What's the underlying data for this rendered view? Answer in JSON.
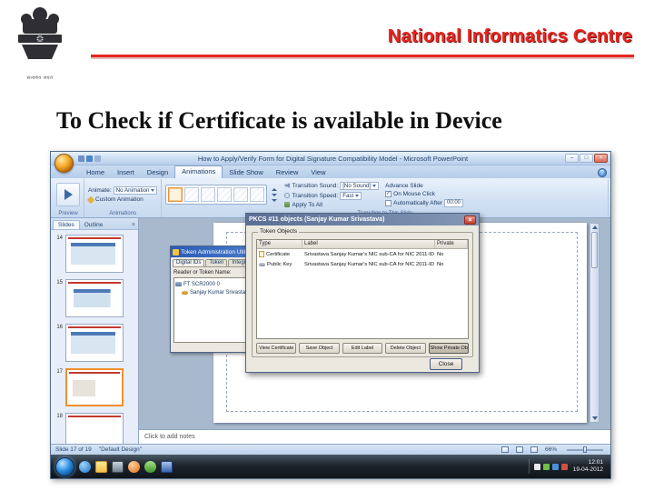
{
  "header": {
    "brand": "National Informatics Centre",
    "motto": "सत्यमेव जयते"
  },
  "title": "To Check if Certificate is available in Device",
  "ppt": {
    "window_title": "How to Apply/Verify Form for Digital Signature Compatibility Model - Microsoft PowerPoint",
    "win_min": "–",
    "win_max": "□",
    "win_close": "×",
    "help": "?",
    "tabs": [
      "Home",
      "Insert",
      "Design",
      "Animations",
      "Slide Show",
      "Review",
      "View"
    ],
    "ribbon": {
      "animate_label": "Animate:",
      "animate_value": "No Animation",
      "custom_animation": "Custom Animation",
      "sound_label": "Transition Sound:",
      "sound_value": "[No Sound]",
      "speed_label": "Transition Speed:",
      "speed_value": "Fast",
      "apply_all": "Apply To All",
      "advance_label": "Advance Slide",
      "mouse_click": "On Mouse Click",
      "auto_after": "Automatically After",
      "auto_time": "00:00",
      "check_glyph": "✓",
      "labels": [
        "Preview",
        "Animations",
        "Transition to This Slide"
      ]
    },
    "panel": {
      "tab_slides": "Slides",
      "tab_outline": "Outline",
      "close": "×",
      "numbers": [
        "14",
        "15",
        "16",
        "17",
        "18"
      ]
    },
    "notes": "Click to add notes",
    "status_left": "Slide 17 of 19",
    "status_theme": "\"Default Design\"",
    "status_zoom": "66%"
  },
  "tokwin": {
    "title": "Token Administration Utility",
    "tabs": [
      "Digital IDs",
      "Token",
      "Integr"
    ],
    "reader_label": "Reader or Token Name:",
    "items": [
      "FT SCR2000 0",
      "Sanjay Kumar Srivastava"
    ]
  },
  "dialog": {
    "title": "PKCS #11 objects (Sanjay Kumar Srivastava)",
    "close_x": "×",
    "group": "Token Objects",
    "col_type": "Type",
    "col_label": "Label",
    "col_private": "Private",
    "rows": [
      {
        "type": "Certificate",
        "label": "Srivastava Sanjay Kumar's NIC sub-CA for NIC 2011-ID",
        "private": "No"
      },
      {
        "type": "Public Key",
        "label": "Srivastava Sanjay Kumar's NIC sub-CA for NIC 2011-ID",
        "private": "No"
      }
    ],
    "buttons": [
      "View Certificate",
      "Save Object",
      "Edit Label",
      "Delete Object",
      "Show Private Objects"
    ],
    "close": "Close"
  },
  "taskbar": {
    "time": "12:01",
    "date": "19-04-2012"
  }
}
